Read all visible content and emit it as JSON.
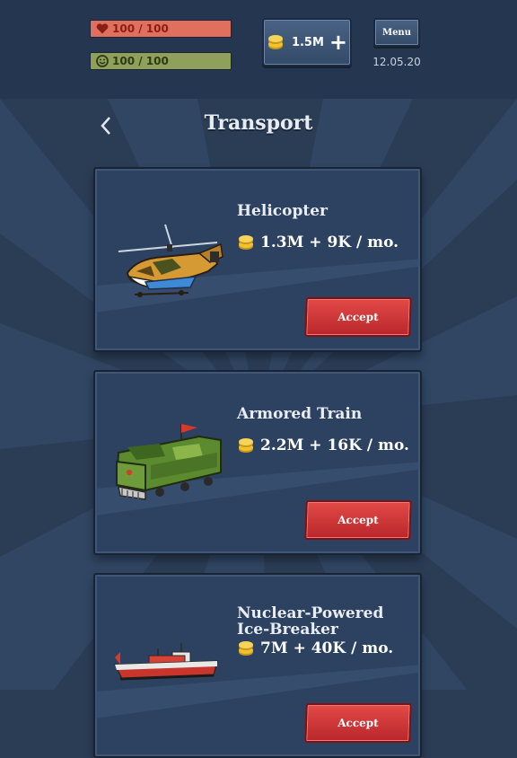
{
  "stats": {
    "health": "100 / 100",
    "morale": "100 / 100"
  },
  "money": {
    "amount": "1.5M",
    "plus": "+"
  },
  "menu": {
    "label": "Menu"
  },
  "date": "12.05.20",
  "page": {
    "title": "Transport"
  },
  "items": [
    {
      "name": "Helicopter",
      "price": "1.3M + 9K / mo.",
      "action": "Accept",
      "icon": "helicopter-icon"
    },
    {
      "name": "Armored Train",
      "price": "2.2M + 16K / mo.",
      "action": "Accept",
      "icon": "armored-train-icon"
    },
    {
      "name": "Nuclear-Powered Ice-Breaker",
      "price": "7M + 40K / mo.",
      "action": "Accept",
      "icon": "icebreaker-icon"
    }
  ],
  "colors": {
    "background": "#2b3d55",
    "card": "#2d4260",
    "accept": "#d93a3b",
    "health": "#e0705e",
    "morale": "#8ea05a",
    "coin": "#f2c12e"
  }
}
